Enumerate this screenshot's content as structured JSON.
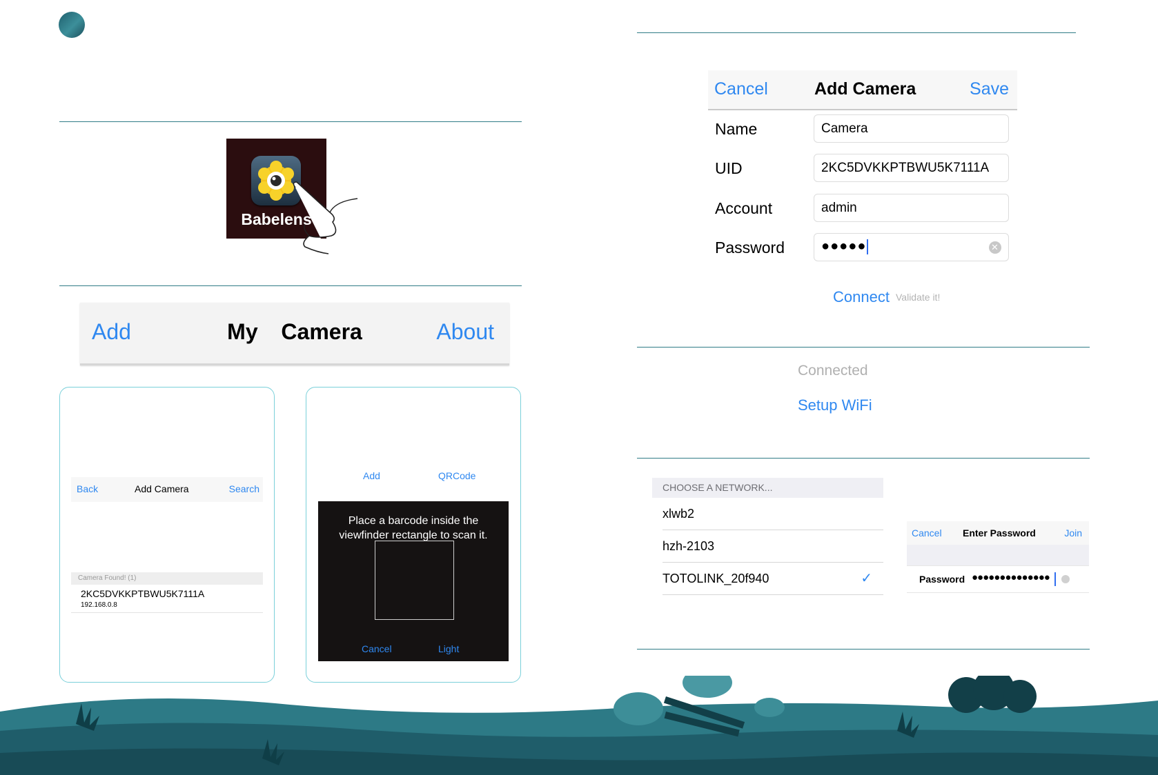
{
  "app_icon": {
    "label": "Babelens"
  },
  "my_camera_bar": {
    "left": "Add",
    "title": "My  Camera",
    "right": "About"
  },
  "search_screen": {
    "nav": {
      "back": "Back",
      "title": "Add Camera",
      "search": "Search"
    },
    "found_header": "Camera Found! (1)",
    "found_uid": "2KC5DVKKPTBWU5K7111A",
    "found_ip": "192.168.0.8"
  },
  "qr_screen": {
    "nav": {
      "add": "Add",
      "qrcode": "QRCode"
    },
    "message_line1": "Place a barcode inside the",
    "message_line2": "viewfinder rectangle to scan it.",
    "cancel": "Cancel",
    "light": "Light"
  },
  "add_camera_form": {
    "cancel": "Cancel",
    "title": "Add Camera",
    "save": "Save",
    "fields": [
      {
        "label": "Name",
        "value": "Camera"
      },
      {
        "label": "UID",
        "value": "2KC5DVKKPTBWU5K7111A"
      },
      {
        "label": "Account",
        "value": "admin"
      },
      {
        "label": "Password",
        "value": "●●●●●"
      }
    ],
    "connect": "Connect",
    "validate": "Validate it!"
  },
  "status": {
    "connected": "Connected",
    "setup_wifi": "Setup WiFi"
  },
  "network_list": {
    "header": "CHOOSE A NETWORK...",
    "networks": [
      "xlwb2",
      "hzh-2103",
      "TOTOLINK_20f940"
    ],
    "checkmark": "✓"
  },
  "enter_password": {
    "cancel": "Cancel",
    "title": "Enter Password",
    "join": "Join",
    "label": "Password",
    "value": "●●●●●●●●●●●●●●"
  },
  "colors": {
    "accent": "#2f88f0",
    "rule": "#2f7b86",
    "frame": "#7ad0da",
    "land": "#2d7a86"
  }
}
